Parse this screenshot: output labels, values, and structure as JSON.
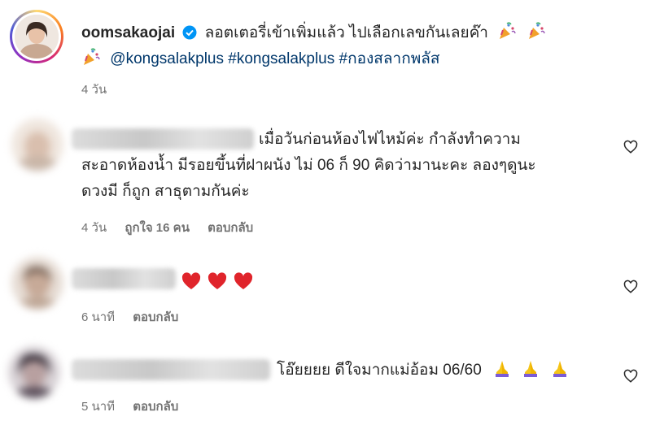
{
  "post": {
    "username": "oomsakaojai",
    "caption": "ลอตเตอรี่เข้าเพิ่มแล้ว ไปเลือกเลขกันเลยค๊า",
    "tags": [
      "@kongsalakplus",
      "#kongsalakplus",
      "#กองสลากพลัส"
    ],
    "time": "4 วัน"
  },
  "comments": [
    {
      "lines": [
        "เมื่อวันก่อนห้องไฟไหม้ค่ะ กำลังทำความ",
        "สะอาดห้องน้ำ มีรอยขึ้นที่ฝาผนัง ไม่ 06 ก็ 90 คิดว่ามานะคะ ลองๆดูนะ",
        "ดวงมี ก็ถูก สาธุตามกันค่ะ"
      ],
      "time": "4 วัน",
      "likes": "ถูกใจ 16 คน",
      "reply": "ตอบกลับ"
    },
    {
      "lines": [],
      "time": "6 นาที",
      "reply": "ตอบกลับ"
    },
    {
      "lines": [
        "โอ๊ยยยย ดีใจมากแม่อ้อม 06/60"
      ],
      "time": "5 นาที",
      "reply": "ตอบกลับ"
    }
  ],
  "icons": [
    "verified-badge-icon",
    "party-popper-icon",
    "heart-emoji-icon",
    "praying-hands-icon",
    "heart-outline-icon"
  ],
  "colors": {
    "verified": "#0095f6",
    "hashtag": "#00376b",
    "meta": "#737373",
    "heart_emoji": "#e0242b",
    "praying": "#f5c518"
  }
}
